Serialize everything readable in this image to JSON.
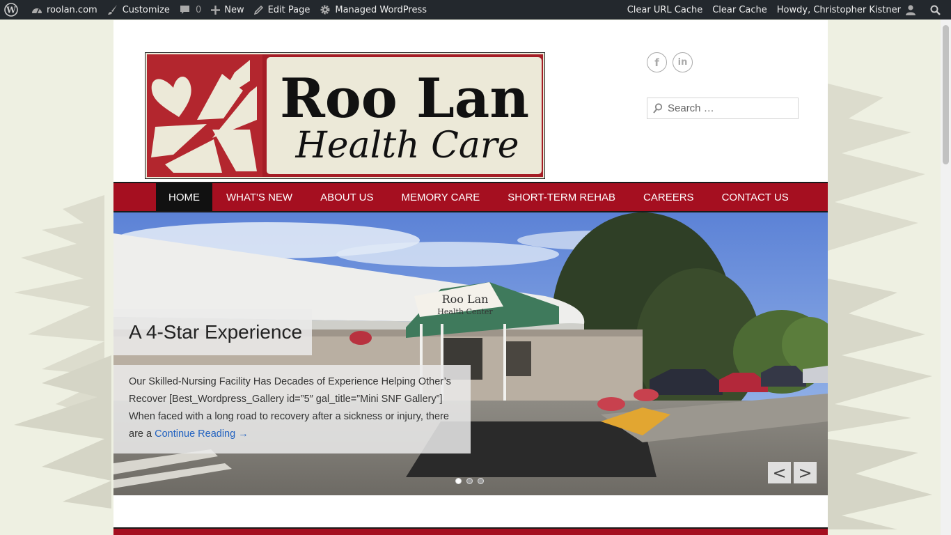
{
  "adminbar": {
    "site": "roolan.com",
    "customize": "Customize",
    "comments_count": "0",
    "new": "New",
    "edit_page": "Edit Page",
    "managed": "Managed WordPress",
    "clear_url_cache": "Clear URL Cache",
    "clear_cache": "Clear Cache",
    "howdy": "Howdy, Christopher Kistner"
  },
  "logo": {
    "line1": "Roo Lan",
    "line2": "Health Care"
  },
  "social": [
    "facebook-icon",
    "linkedin-icon"
  ],
  "search": {
    "placeholder": "Search …"
  },
  "nav": {
    "items": [
      {
        "label": "HOME",
        "active": true
      },
      {
        "label": "WHAT'S NEW"
      },
      {
        "label": "ABOUT US"
      },
      {
        "label": "MEMORY CARE"
      },
      {
        "label": "SHORT-TERM REHAB"
      },
      {
        "label": "CAREERS"
      },
      {
        "label": "CONTACT US"
      }
    ]
  },
  "slider": {
    "title": "A 4-Star Experience",
    "excerpt": "Our Skilled-Nursing Facility Has Decades of Experience Helping Other’s Recover [Best_Wordpress_Gallery id=”5″ gal_title=”Mini SNF Gallery”] When faced with a long road to recovery after a sickness or injury, there are a",
    "read_more": "Continue Reading →",
    "prev": "<",
    "next": ">",
    "slides": 3,
    "active_slide": 1,
    "photo": {
      "sign_line1": "Roo Lan",
      "sign_line2": "Health Center"
    }
  },
  "colors": {
    "brand_red": "#a50f20",
    "admin_bar": "#23282d",
    "link": "#2262c0"
  }
}
